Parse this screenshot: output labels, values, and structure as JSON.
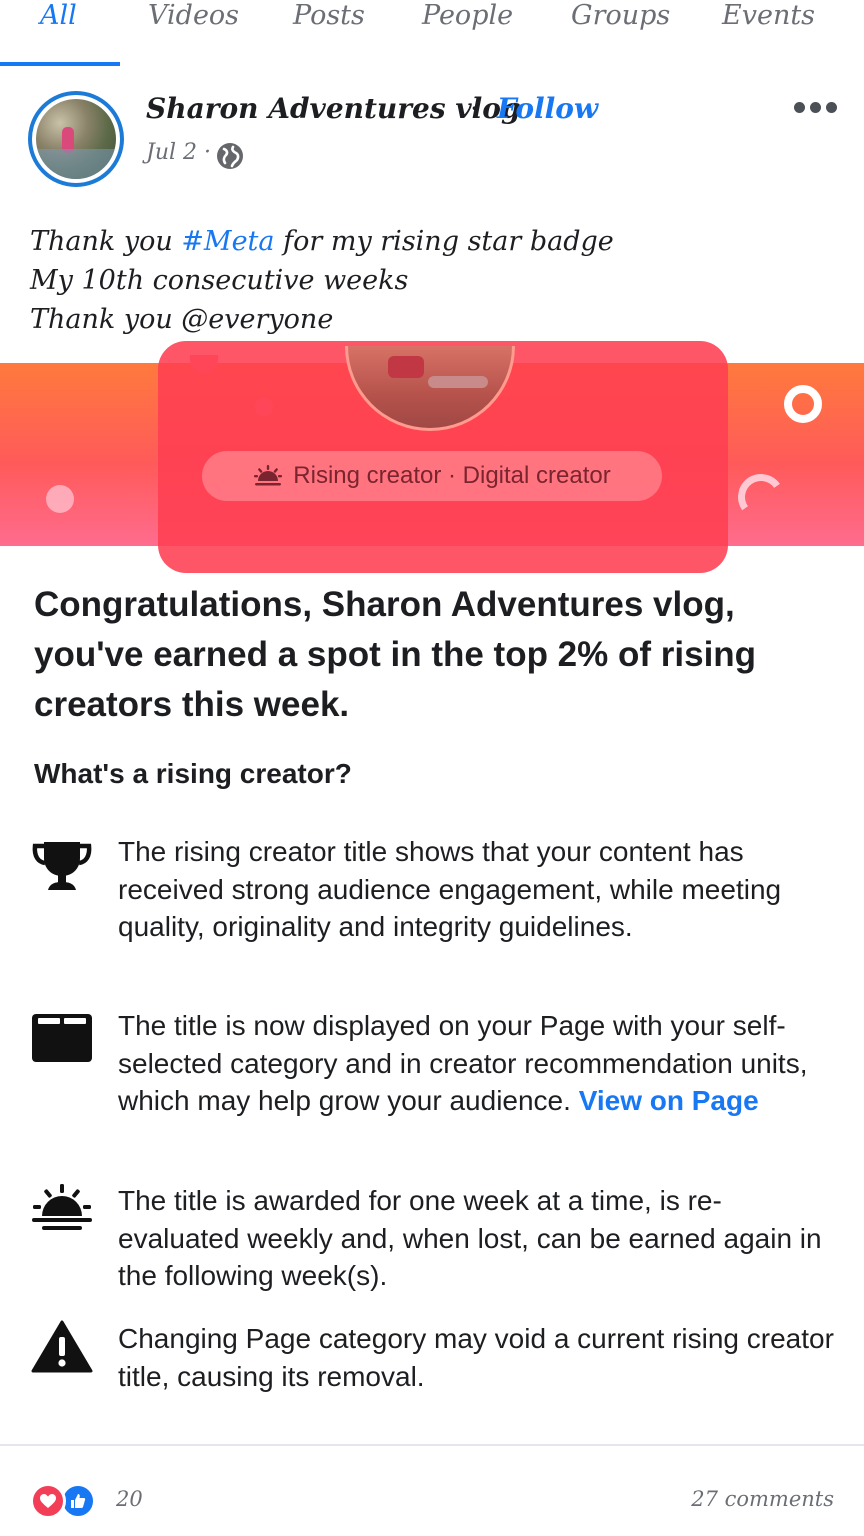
{
  "tabs": [
    {
      "label": "All",
      "active": true
    },
    {
      "label": "Videos",
      "active": false
    },
    {
      "label": "Posts",
      "active": false
    },
    {
      "label": "People",
      "active": false
    },
    {
      "label": "Groups",
      "active": false
    },
    {
      "label": "Events",
      "active": false
    }
  ],
  "post": {
    "author": "Sharon Adventures vlog",
    "separator": "·",
    "follow_label": "Follow",
    "date": "Jul 2 ·",
    "privacy_icon": "globe-icon",
    "more_icon": "more-options-icon",
    "text": {
      "line1_before": "Thank you ",
      "hashtag": "#Meta",
      "line1_after": " for my rising star badge",
      "line2": "My 10th consecutive weeks",
      "line3": "Thank you @everyone"
    }
  },
  "badge": {
    "pill_icon": "sunrise-icon",
    "pill_label": "Rising creator · Digital creator"
  },
  "content": {
    "headline": "Congratulations, Sharon Adventures vlog, you've earned a spot in the top 2% of rising creators this week.",
    "subhead": "What's a rising creator?",
    "items": [
      {
        "icon": "trophy-icon",
        "text": "The rising creator title shows that your content has received strong audience engagement, while meeting quality, originality and integrity guidelines."
      },
      {
        "icon": "page-card-icon",
        "text": "The title is now displayed on your Page with your self-selected category and in creator recommendation units, which may help grow your audience. ",
        "link": "View on Page"
      },
      {
        "icon": "sunrise-icon",
        "text": "The title is awarded for one week at a time, is re-evaluated weekly and, when lost, can be earned again in the following week(s)."
      },
      {
        "icon": "warning-icon",
        "text": "Changing Page category may void a current rising creator title, causing its removal."
      }
    ]
  },
  "footer": {
    "reactions": [
      "heart-icon",
      "like-icon"
    ],
    "reaction_count": "20",
    "comments": "27 comments"
  },
  "colors": {
    "accent": "#1877f2",
    "banner_top": "#ff7a3d",
    "banner_bottom": "#ff6c8e",
    "overlay": "#ff3f52"
  }
}
